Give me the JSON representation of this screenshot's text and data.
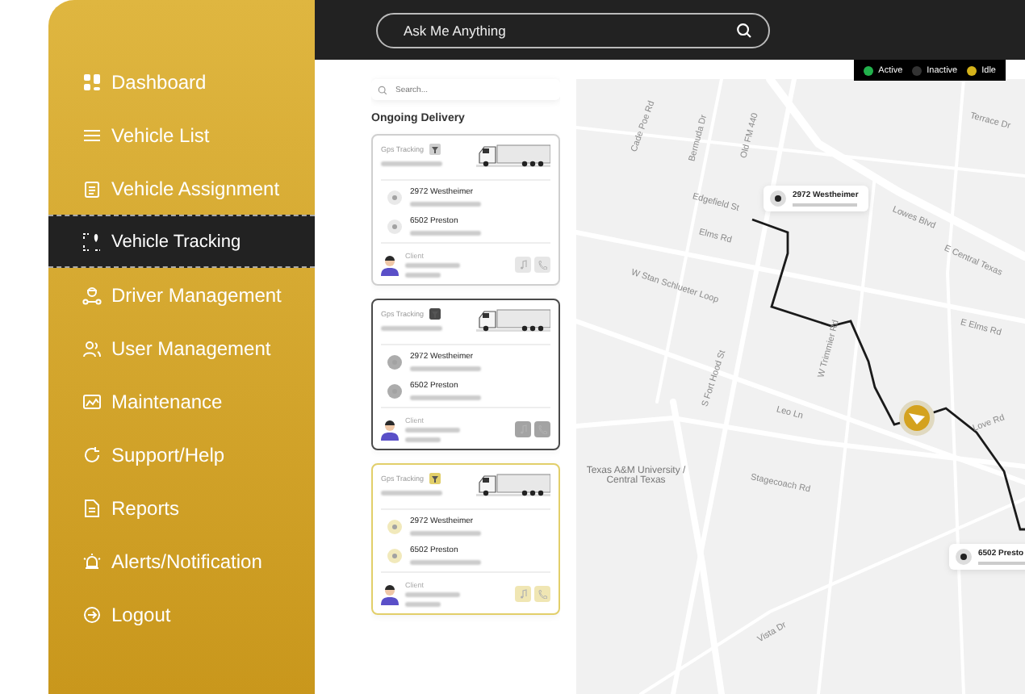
{
  "sidebar": {
    "items": [
      {
        "label": "Dashboard",
        "selected": false
      },
      {
        "label": "Vehicle List",
        "selected": false
      },
      {
        "label": "Vehicle Assignment",
        "selected": false
      },
      {
        "label": "Vehicle Tracking",
        "selected": true
      },
      {
        "label": "Driver Management",
        "selected": false
      },
      {
        "label": "User Management",
        "selected": false
      },
      {
        "label": "Maintenance",
        "selected": false
      },
      {
        "label": "Support/Help",
        "selected": false
      },
      {
        "label": "Reports",
        "selected": false
      },
      {
        "label": "Alerts/Notification",
        "selected": false
      },
      {
        "label": "Logout",
        "selected": false
      }
    ]
  },
  "search": {
    "placeholder": "Ask Me Anything"
  },
  "legend": [
    {
      "label": "Active",
      "color": "#22b14c"
    },
    {
      "label": "Inactive",
      "color": "#333333"
    },
    {
      "label": "Idle",
      "color": "#d4b21a"
    }
  ],
  "deliveries": {
    "search_placeholder": "Search...",
    "title": "Ongoing Delivery",
    "cards": [
      {
        "label": "Gps Tracking",
        "color": "#cfcfcf",
        "stops": [
          "2972 Westheimer",
          "6502 Preston"
        ],
        "client_label": "Client"
      },
      {
        "label": "Gps Tracking",
        "color": "#4a4a4a",
        "stops": [
          "2972 Westheimer",
          "6502 Preston"
        ],
        "client_label": "Client"
      },
      {
        "label": "Gps Tracking",
        "color": "#e2cf6a",
        "stops": [
          "2972 Westheimer",
          "6502 Preston"
        ],
        "client_label": "Client"
      }
    ]
  },
  "map": {
    "labels": [
      "Cade Poe Rd",
      "Bermuda Dr",
      "Old FM 440",
      "Edgefield St",
      "Elms Rd",
      "W Stan Schlueter Loop",
      "S Fort Hood St",
      "W Trimmier Rd",
      "Lowes Blvd",
      "E Central Texas",
      "E Elms Rd",
      "Terrace Dr",
      "Leo Ln",
      "Stagecoach Rd",
      "Texas A&M University / Central Texas",
      "Vista Dr",
      "Love Rd"
    ],
    "pins": [
      {
        "address": "2972 Westheimer"
      },
      {
        "address": "6502 Presto"
      }
    ]
  }
}
